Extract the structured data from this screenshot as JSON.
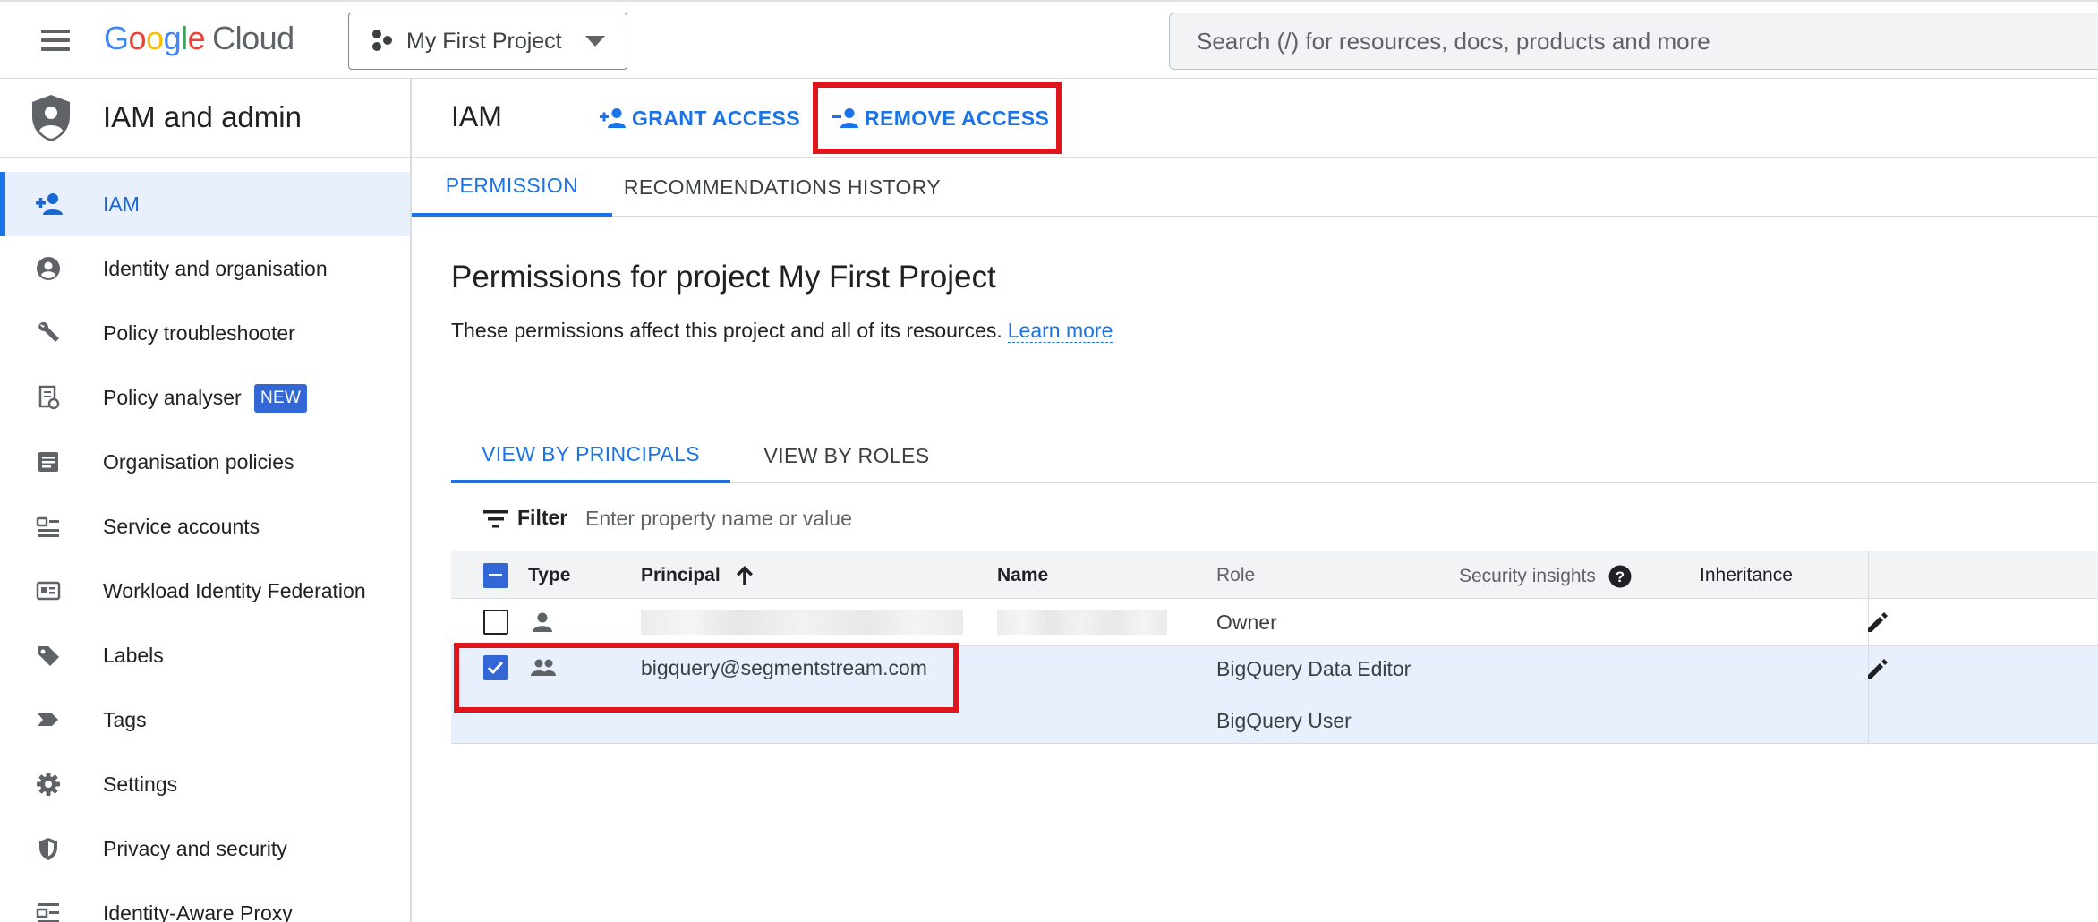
{
  "header": {
    "logo_google": "Google",
    "logo_cloud": "Cloud",
    "project_name": "My First Project",
    "search_placeholder": "Search (/) for resources, docs, products and more"
  },
  "sidebar": {
    "title": "IAM and admin",
    "items": [
      {
        "label": "IAM",
        "icon": "person-add-icon",
        "active": true
      },
      {
        "label": "Identity and organisation",
        "icon": "account-circle-icon"
      },
      {
        "label": "Policy troubleshooter",
        "icon": "wrench-icon"
      },
      {
        "label": "Policy analyser",
        "icon": "policy-doc-icon",
        "badge": "NEW"
      },
      {
        "label": "Organisation policies",
        "icon": "article-icon"
      },
      {
        "label": "Service accounts",
        "icon": "service-account-icon"
      },
      {
        "label": "Workload Identity Federation",
        "icon": "id-card-icon"
      },
      {
        "label": "Labels",
        "icon": "label-icon"
      },
      {
        "label": "Tags",
        "icon": "tag-icon"
      },
      {
        "label": "Settings",
        "icon": "gear-icon"
      },
      {
        "label": "Privacy and security",
        "icon": "security-shield-icon"
      },
      {
        "label": "Identity-Aware Proxy",
        "icon": "proxy-icon"
      }
    ]
  },
  "main": {
    "title": "IAM",
    "grant_access": "GRANT ACCESS",
    "remove_access": "REMOVE ACCESS",
    "tabs": [
      "PERMISSION",
      "RECOMMENDATIONS HISTORY"
    ],
    "heading": "Permissions for project My First Project",
    "description": "These permissions affect this project and all of its resources.",
    "learn_more": "Learn more",
    "view_tabs": [
      "VIEW BY PRINCIPALS",
      "VIEW BY ROLES"
    ],
    "filter_label": "Filter",
    "filter_placeholder": "Enter property name or value"
  },
  "table": {
    "columns": {
      "type": "Type",
      "principal": "Principal",
      "name": "Name",
      "role": "Role",
      "security_insights": "Security insights",
      "inheritance": "Inheritance"
    },
    "rows": [
      {
        "checked": false,
        "type_icon": "person-icon",
        "principal": "",
        "name": "",
        "roles": [
          "Owner"
        ]
      },
      {
        "checked": true,
        "type_icon": "group-icon",
        "principal": "bigquery@segmentstream.com",
        "name": "",
        "roles": [
          "BigQuery Data Editor",
          "BigQuery User"
        ]
      }
    ]
  },
  "colors": {
    "accent": "#1a73e8",
    "highlight_box": "#e0151c",
    "selected_row": "#e8f0fe"
  }
}
